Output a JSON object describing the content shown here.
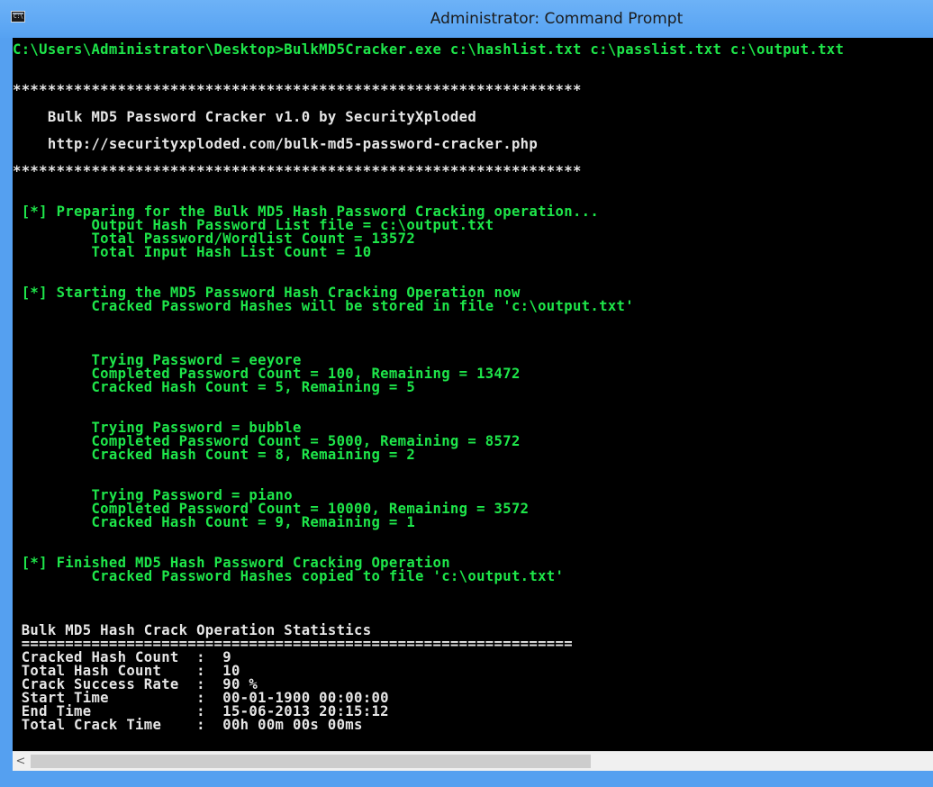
{
  "window": {
    "title": "Administrator: Command Prompt",
    "icon": "cmd-icon"
  },
  "console": {
    "command": "C:\\Users\\Administrator\\Desktop>BulkMD5Cracker.exe c:\\hashlist.txt c:\\passlist.txt c:\\output.txt",
    "lines": [
      {
        "text": "",
        "style": "gray"
      },
      {
        "text": "",
        "style": "gray"
      },
      {
        "text": "*****************************************************************",
        "style": "white"
      },
      {
        "text": "",
        "style": "gray"
      },
      {
        "text": "    Bulk MD5 Password Cracker v1.0 by SecurityXploded",
        "style": "white"
      },
      {
        "text": "",
        "style": "gray"
      },
      {
        "text": "    http://securityxploded.com/bulk-md5-password-cracker.php",
        "style": "white"
      },
      {
        "text": "",
        "style": "gray"
      },
      {
        "text": "*****************************************************************",
        "style": "white"
      },
      {
        "text": "",
        "style": "gray"
      },
      {
        "text": "",
        "style": "gray"
      },
      {
        "text": " [*] Preparing for the Bulk MD5 Hash Password Cracking operation...",
        "style": "green"
      },
      {
        "text": "         Output Hash Password List file = c:\\output.txt",
        "style": "green"
      },
      {
        "text": "         Total Password/Wordlist Count = 13572",
        "style": "green"
      },
      {
        "text": "         Total Input Hash List Count = 10",
        "style": "green"
      },
      {
        "text": "",
        "style": "gray"
      },
      {
        "text": "",
        "style": "gray"
      },
      {
        "text": " [*] Starting the MD5 Password Hash Cracking Operation now",
        "style": "green"
      },
      {
        "text": "         Cracked Password Hashes will be stored in file 'c:\\output.txt'",
        "style": "green"
      },
      {
        "text": "",
        "style": "gray"
      },
      {
        "text": "",
        "style": "gray"
      },
      {
        "text": "",
        "style": "gray"
      },
      {
        "text": "         Trying Password = eeyore",
        "style": "green"
      },
      {
        "text": "         Completed Password Count = 100, Remaining = 13472",
        "style": "green"
      },
      {
        "text": "         Cracked Hash Count = 5, Remaining = 5",
        "style": "green"
      },
      {
        "text": "",
        "style": "gray"
      },
      {
        "text": "",
        "style": "gray"
      },
      {
        "text": "         Trying Password = bubble",
        "style": "green"
      },
      {
        "text": "         Completed Password Count = 5000, Remaining = 8572",
        "style": "green"
      },
      {
        "text": "         Cracked Hash Count = 8, Remaining = 2",
        "style": "green"
      },
      {
        "text": "",
        "style": "gray"
      },
      {
        "text": "",
        "style": "gray"
      },
      {
        "text": "         Trying Password = piano",
        "style": "green"
      },
      {
        "text": "         Completed Password Count = 10000, Remaining = 3572",
        "style": "green"
      },
      {
        "text": "         Cracked Hash Count = 9, Remaining = 1",
        "style": "green"
      },
      {
        "text": "",
        "style": "gray"
      },
      {
        "text": "",
        "style": "gray"
      },
      {
        "text": " [*] Finished MD5 Hash Password Cracking Operation",
        "style": "green"
      },
      {
        "text": "         Cracked Password Hashes copied to file 'c:\\output.txt'",
        "style": "green"
      },
      {
        "text": "",
        "style": "gray"
      },
      {
        "text": "",
        "style": "gray"
      },
      {
        "text": "",
        "style": "gray"
      },
      {
        "text": " Bulk MD5 Hash Crack Operation Statistics",
        "style": "white"
      },
      {
        "text": " ===============================================================",
        "style": "white"
      },
      {
        "text": " Cracked Hash Count  :  9",
        "style": "white"
      },
      {
        "text": " Total Hash Count    :  10",
        "style": "white"
      },
      {
        "text": " Crack Success Rate  :  90 %",
        "style": "white"
      },
      {
        "text": " Start Time          :  00-01-1900 00:00:00",
        "style": "white"
      },
      {
        "text": " End Time            :  15-06-2013 20:15:12",
        "style": "white"
      },
      {
        "text": " Total Crack Time    :  00h 00m 00s 00ms",
        "style": "white"
      }
    ]
  },
  "scrollbar": {
    "left_arrow": "<",
    "position": 0.0
  },
  "colors": {
    "prompt": "#1ee64a",
    "output_green": "#1ee64a",
    "output_white": "#e6e6e6",
    "background": "#000000",
    "frame": "#55a0f0"
  }
}
